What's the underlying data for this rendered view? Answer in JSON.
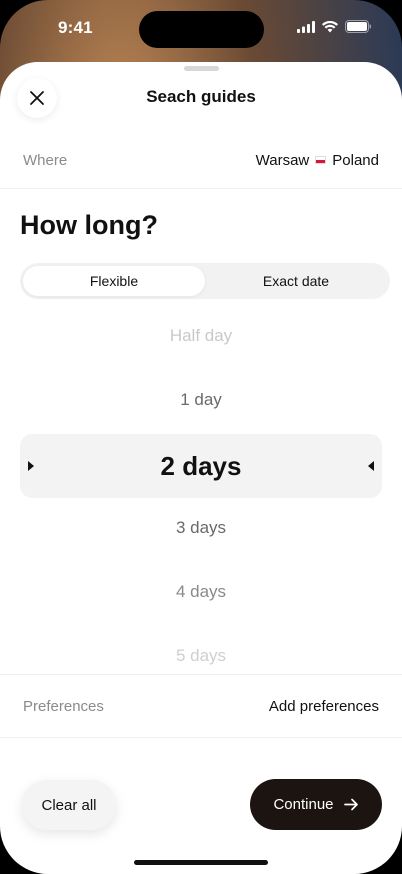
{
  "status_bar": {
    "time": "9:41"
  },
  "sheet": {
    "title": "Seach guides"
  },
  "where": {
    "label": "Where",
    "city": "Warsaw",
    "country": "Poland"
  },
  "duration": {
    "heading": "How long?"
  },
  "mode_tabs": [
    {
      "label": "Flexible",
      "active": true
    },
    {
      "label": "Exact date",
      "active": false
    }
  ],
  "picker": {
    "items": [
      "Half day",
      "1 day",
      "2 days",
      "3 days",
      "4 days",
      "5 days"
    ],
    "selected": "2 days"
  },
  "preferences": {
    "label": "Preferences",
    "action": "Add preferences"
  },
  "actions": {
    "clear_label": "Clear all",
    "continue_label": "Continue"
  },
  "colors": {
    "primary_button": "#1c1410",
    "selected_band": "#f3f3f3",
    "muted_text": "#8a8a8a"
  },
  "icons": {
    "close": "close-icon",
    "arrow": "arrow-right-icon",
    "flag": "poland-flag-icon"
  }
}
